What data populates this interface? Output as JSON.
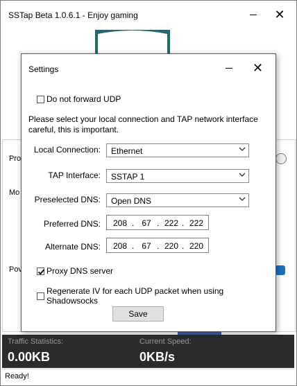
{
  "app": {
    "title": "SSTap Beta 1.0.6.1 - Enjoy gaming"
  },
  "background": {
    "labels": [
      "Pro",
      "Mo",
      "Pov"
    ]
  },
  "stats": {
    "traffic_label": "Traffic Statistics:",
    "traffic_value": "0.00KB",
    "speed_label": "Current Speed:",
    "speed_value": "0KB/s"
  },
  "status": {
    "text": "Ready!"
  },
  "dialog": {
    "title": "Settings",
    "do_not_forward_udp": {
      "label": "Do not forward UDP",
      "checked": false
    },
    "info": "Please select your local connection and TAP network interface careful, this is important.",
    "local_connection": {
      "label": "Local Connection:",
      "value": "Ethernet"
    },
    "tap_interface": {
      "label": "TAP Interface:",
      "value": "SSTAP 1"
    },
    "preselected_dns": {
      "label": "Preselected DNS:",
      "value": "Open DNS"
    },
    "preferred_dns": {
      "label": "Preferred DNS:",
      "octets": [
        "208",
        "67",
        "222",
        "222"
      ]
    },
    "alternate_dns": {
      "label": "Alternate DNS:",
      "octets": [
        "208",
        "67",
        "220",
        "220"
      ]
    },
    "proxy_dns": {
      "label": "Proxy DNS server",
      "checked": true
    },
    "regenerate_iv": {
      "label": "Regenerate IV for each UDP packet when using Shadowsocks",
      "checked": false
    },
    "save_label": "Save"
  },
  "colors": {
    "stats_bg": "#2b2b2b",
    "logo_teal": "#1f6b70",
    "accent_blue": "#1e73be"
  },
  "icons": [
    "minimize-icon",
    "close-icon",
    "chevron-down-icon",
    "checkmark-icon",
    "cursor-icon",
    "shield-logo-icon"
  ]
}
